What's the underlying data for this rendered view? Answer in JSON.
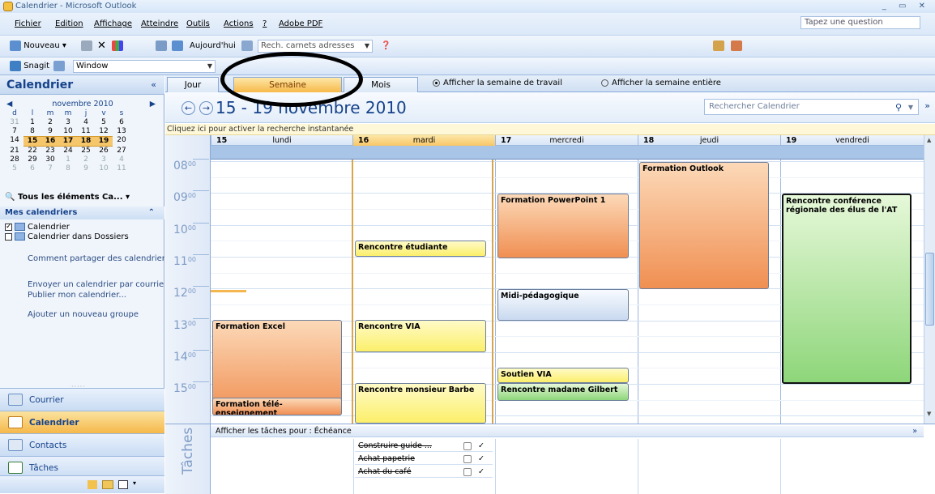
{
  "window": {
    "title": "Calendrier - Microsoft Outlook",
    "controls": "_ ▭ ✕"
  },
  "menubar": {
    "items": [
      "Fichier",
      "Edition",
      "Affichage",
      "Atteindre",
      "Outils",
      "Actions",
      "?",
      "Adobe PDF"
    ],
    "help_placeholder": "Tapez une question"
  },
  "toolbar1": {
    "new_label": "Nouveau",
    "today_label": "Aujourd'hui",
    "addressbook_placeholder": "Rech. carnets adresses"
  },
  "toolbar2": {
    "snagit_label": "Snagit",
    "window_combo": "Window"
  },
  "nav": {
    "header": "Calendrier",
    "minical": {
      "month": "novembre 2010",
      "dow": [
        "d",
        "l",
        "m",
        "m",
        "j",
        "v",
        "s"
      ],
      "weeks": [
        [
          "31",
          "1",
          "2",
          "3",
          "4",
          "5",
          "6"
        ],
        [
          "7",
          "8",
          "9",
          "10",
          "11",
          "12",
          "13"
        ],
        [
          "14",
          "15",
          "16",
          "17",
          "18",
          "19",
          "20"
        ],
        [
          "21",
          "22",
          "23",
          "24",
          "25",
          "26",
          "27"
        ],
        [
          "28",
          "29",
          "30",
          "1",
          "2",
          "3",
          "4"
        ],
        [
          "5",
          "6",
          "7",
          "8",
          "9",
          "10",
          "11"
        ]
      ]
    },
    "all_items": "Tous les éléments Ca...",
    "my_calendars": "Mes calendriers",
    "calendars": [
      "Calendrier",
      "Calendrier dans Dossiers"
    ],
    "links": [
      "Comment partager des calendriers",
      "Envoyer un calendrier par courrier",
      "Publier mon calendrier...",
      "Ajouter un nouveau groupe"
    ],
    "buttons": {
      "mail": "Courrier",
      "calendar": "Calendrier",
      "contacts": "Contacts",
      "tasks": "Tâches"
    }
  },
  "views": {
    "day": "Jour",
    "week": "Semaine",
    "month": "Mois",
    "opt_work_week": "Afficher la semaine de travail",
    "opt_full_week": "Afficher la semaine entière"
  },
  "date_range": "15 - 19 novembre 2010",
  "search_placeholder": "Rechercher Calendrier",
  "info_bar": "Cliquez ici pour activer la recherche instantanée",
  "days": [
    {
      "num": "15",
      "name": "lundi"
    },
    {
      "num": "16",
      "name": "mardi"
    },
    {
      "num": "17",
      "name": "mercredi"
    },
    {
      "num": "18",
      "name": "jeudi"
    },
    {
      "num": "19",
      "name": "vendredi"
    }
  ],
  "hours": [
    "08",
    "09",
    "10",
    "11",
    "12",
    "13",
    "14",
    "15"
  ],
  "hour_suffix": "00",
  "events": {
    "formation_outlook": "Formation Outlook",
    "formation_powerpoint": "Formation PowerPoint 1",
    "rencontre_conference": "Rencontre conférence régionale des élus de l'AT",
    "rencontre_etudiante": "Rencontre étudiante",
    "midi_pedagogique": "Midi-pédagogique",
    "formation_excel": "Formation Excel",
    "rencontre_via": "Rencontre VIA",
    "soutien_via": "Soutien VIA",
    "rencontre_gilbert": "Rencontre madame Gilbert",
    "rencontre_barbe": "Rencontre monsieur Barbe",
    "formation_tele": "Formation télé-enseignement"
  },
  "tasks": {
    "label": "Tâches",
    "header": "Afficher les tâches pour : Échéance",
    "items": [
      "Construire guide ...",
      "Achat papetrie",
      "Achat du café"
    ]
  }
}
